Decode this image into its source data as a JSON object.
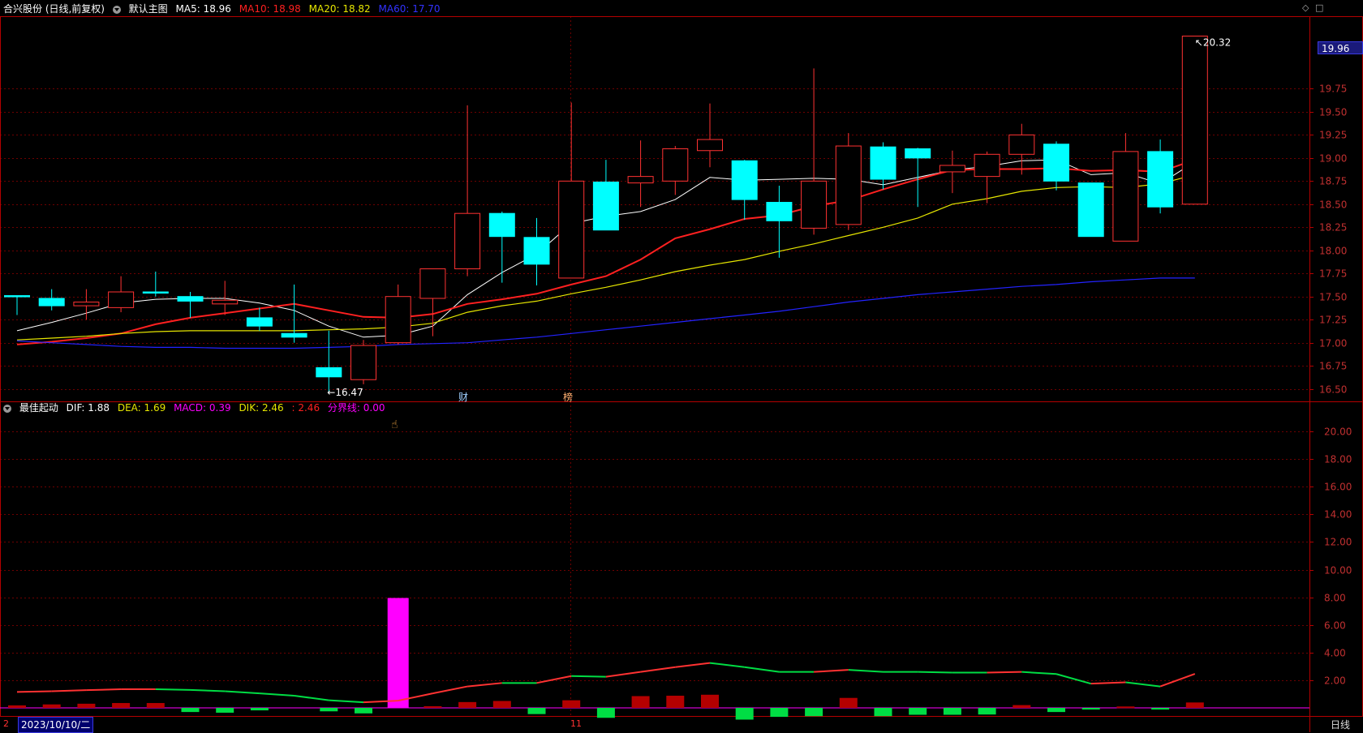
{
  "main_header": {
    "title": "合兴股份 (日线,前复权)",
    "template": "默认主图",
    "ma5": "MA5: 18.96",
    "ma10": "MA10: 18.98",
    "ma20": "MA20: 18.82",
    "ma60": "MA60: 17.70"
  },
  "sub_header": {
    "title": "最佳起动",
    "dif": "DIF: 1.88",
    "dea": "DEA: 1.69",
    "macd": "MACD: 0.39",
    "dik": "DIK: 2.46",
    "dik2": ": 2.46",
    "line": "分界线: 0.00"
  },
  "current_price": "19.96",
  "date_label": "2023/10/10/二",
  "date_marker_left": "2",
  "date_marker_mid": "11",
  "period": "日线",
  "event_tags": [
    "财",
    "榜"
  ],
  "colors": {
    "up": "#ff3232",
    "down": "#00ffff",
    "ma5": "#ffffff",
    "ma10": "#ff2020",
    "ma20": "#e6e600",
    "ma60": "#2323ff",
    "grid": "#6e0000",
    "axis": "#b40000",
    "macd_up": "#b40000",
    "macd_down": "#00dd44",
    "spike": "#ff00ff"
  },
  "chart_data": [
    {
      "type": "candlestick",
      "title": "合兴股份 (日线,前复权)",
      "ylim": [
        16.4,
        20.5
      ],
      "yticks": [
        16.5,
        16.75,
        17.0,
        17.25,
        17.5,
        17.75,
        18.0,
        18.25,
        18.5,
        18.75,
        19.0,
        19.25,
        19.5,
        19.75
      ],
      "high_label": "20.32",
      "low_label": "16.47",
      "candles": [
        {
          "o": 17.51,
          "h": 17.51,
          "l": 17.3,
          "c": 17.5
        },
        {
          "o": 17.48,
          "h": 17.58,
          "l": 17.35,
          "c": 17.4
        },
        {
          "o": 17.4,
          "h": 17.58,
          "l": 17.25,
          "c": 17.44
        },
        {
          "o": 17.38,
          "h": 17.72,
          "l": 17.33,
          "c": 17.55
        },
        {
          "o": 17.55,
          "h": 17.77,
          "l": 17.5,
          "c": 17.54
        },
        {
          "o": 17.5,
          "h": 17.55,
          "l": 17.27,
          "c": 17.45
        },
        {
          "o": 17.42,
          "h": 17.67,
          "l": 17.3,
          "c": 17.46
        },
        {
          "o": 17.27,
          "h": 17.38,
          "l": 17.13,
          "c": 17.18
        },
        {
          "o": 17.1,
          "h": 17.63,
          "l": 17.0,
          "c": 17.06
        },
        {
          "o": 16.73,
          "h": 17.13,
          "l": 16.47,
          "c": 16.63
        },
        {
          "o": 16.6,
          "h": 17.03,
          "l": 16.55,
          "c": 16.97
        },
        {
          "o": 17.0,
          "h": 17.63,
          "l": 16.98,
          "c": 17.5
        },
        {
          "o": 17.48,
          "h": 17.8,
          "l": 17.07,
          "c": 17.8
        },
        {
          "o": 17.8,
          "h": 19.57,
          "l": 17.72,
          "c": 18.4
        },
        {
          "o": 18.4,
          "h": 18.42,
          "l": 17.65,
          "c": 18.15
        },
        {
          "o": 18.14,
          "h": 18.35,
          "l": 17.62,
          "c": 17.85
        },
        {
          "o": 17.7,
          "h": 19.6,
          "l": 17.7,
          "c": 18.75
        },
        {
          "o": 18.74,
          "h": 18.98,
          "l": 18.22,
          "c": 18.22
        },
        {
          "o": 18.73,
          "h": 19.19,
          "l": 18.47,
          "c": 18.8
        },
        {
          "o": 18.75,
          "h": 19.13,
          "l": 18.6,
          "c": 19.1
        },
        {
          "o": 19.08,
          "h": 19.59,
          "l": 18.9,
          "c": 19.2
        },
        {
          "o": 18.97,
          "h": 18.98,
          "l": 18.33,
          "c": 18.55
        },
        {
          "o": 18.52,
          "h": 18.7,
          "l": 17.92,
          "c": 18.32
        },
        {
          "o": 18.24,
          "h": 19.97,
          "l": 18.17,
          "c": 18.75
        },
        {
          "o": 18.28,
          "h": 19.27,
          "l": 18.22,
          "c": 19.13
        },
        {
          "o": 19.12,
          "h": 19.17,
          "l": 18.66,
          "c": 18.77
        },
        {
          "o": 19.1,
          "h": 19.11,
          "l": 18.47,
          "c": 19.0
        },
        {
          "o": 18.85,
          "h": 19.08,
          "l": 18.62,
          "c": 18.92
        },
        {
          "o": 18.8,
          "h": 19.07,
          "l": 18.51,
          "c": 19.04
        },
        {
          "o": 19.04,
          "h": 19.37,
          "l": 18.82,
          "c": 19.25
        },
        {
          "o": 19.15,
          "h": 19.18,
          "l": 18.65,
          "c": 18.75
        },
        {
          "o": 18.73,
          "h": 18.73,
          "l": 18.15,
          "c": 18.15
        },
        {
          "o": 18.1,
          "h": 19.27,
          "l": 18.1,
          "c": 19.07
        },
        {
          "o": 19.07,
          "h": 19.2,
          "l": 18.4,
          "c": 18.47
        },
        {
          "o": 18.5,
          "h": 20.32,
          "l": 18.5,
          "c": 20.32
        }
      ],
      "series": [
        {
          "name": "MA5",
          "values": [
            17.13,
            17.22,
            17.32,
            17.43,
            17.47,
            17.48,
            17.48,
            17.43,
            17.35,
            17.18,
            17.06,
            17.08,
            17.18,
            17.52,
            17.76,
            17.96,
            18.29,
            18.37,
            18.42,
            18.55,
            18.79,
            18.76,
            18.77,
            18.78,
            18.77,
            18.71,
            18.79,
            18.87,
            18.91,
            18.97,
            18.98,
            18.82,
            18.84,
            18.72,
            18.96
          ]
        },
        {
          "name": "MA10",
          "values": [
            16.98,
            17.01,
            17.05,
            17.1,
            17.2,
            17.27,
            17.32,
            17.37,
            17.42,
            17.35,
            17.28,
            17.27,
            17.31,
            17.42,
            17.47,
            17.53,
            17.63,
            17.72,
            17.9,
            18.13,
            18.23,
            18.34,
            18.38,
            18.48,
            18.54,
            18.66,
            18.77,
            18.87,
            18.88,
            18.88,
            18.89,
            18.86,
            18.87,
            18.85,
            18.98
          ]
        },
        {
          "name": "MA20",
          "values": [
            17.03,
            17.05,
            17.07,
            17.1,
            17.12,
            17.13,
            17.13,
            17.13,
            17.13,
            17.14,
            17.15,
            17.17,
            17.21,
            17.33,
            17.4,
            17.45,
            17.53,
            17.6,
            17.68,
            17.77,
            17.84,
            17.9,
            17.99,
            18.07,
            18.16,
            18.25,
            18.35,
            18.5,
            18.56,
            18.64,
            18.68,
            18.69,
            18.68,
            18.72,
            18.82
          ]
        },
        {
          "name": "MA60",
          "values": [
            17.02,
            17.0,
            16.98,
            16.96,
            16.95,
            16.95,
            16.94,
            16.94,
            16.94,
            16.95,
            16.96,
            16.98,
            16.99,
            17.0,
            17.03,
            17.06,
            17.1,
            17.14,
            17.18,
            17.22,
            17.26,
            17.3,
            17.34,
            17.39,
            17.44,
            17.48,
            17.52,
            17.55,
            17.58,
            17.61,
            17.63,
            17.66,
            17.68,
            17.7,
            17.7
          ]
        }
      ]
    },
    {
      "type": "bar",
      "title": "最佳起动",
      "ylim": [
        0,
        21
      ],
      "yticks": [
        2,
        4,
        6,
        8,
        10,
        12,
        14,
        16,
        18,
        20
      ],
      "macd_bars": [
        0.18,
        0.25,
        0.3,
        0.35,
        0.35,
        -0.3,
        -0.35,
        -0.18,
        0,
        -0.25,
        -0.4,
        7.95,
        0.12,
        0.42,
        0.5,
        -0.45,
        0.55,
        -0.72,
        0.85,
        0.88,
        0.95,
        -0.85,
        -0.65,
        -0.6,
        0.72,
        -0.6,
        -0.5,
        -0.5,
        -0.48,
        0.2,
        -0.3,
        -0.12,
        0.1,
        -0.12,
        0.39
      ],
      "dik_line": [
        1.15,
        1.2,
        1.28,
        1.35,
        1.35,
        1.3,
        1.2,
        1.05,
        0.88,
        0.55,
        0.4,
        0.52,
        1.05,
        1.55,
        1.8,
        1.8,
        2.3,
        2.25,
        2.6,
        2.95,
        3.25,
        2.95,
        2.6,
        2.6,
        2.75,
        2.6,
        2.6,
        2.55,
        2.55,
        2.6,
        2.45,
        1.75,
        1.85,
        1.55,
        2.46
      ],
      "dik_up": [
        true,
        true,
        true,
        true,
        true,
        false,
        false,
        false,
        false,
        false,
        false,
        true,
        true,
        true,
        true,
        false,
        true,
        false,
        true,
        true,
        true,
        false,
        false,
        false,
        true,
        false,
        false,
        false,
        false,
        true,
        false,
        false,
        true,
        false,
        true
      ]
    }
  ]
}
